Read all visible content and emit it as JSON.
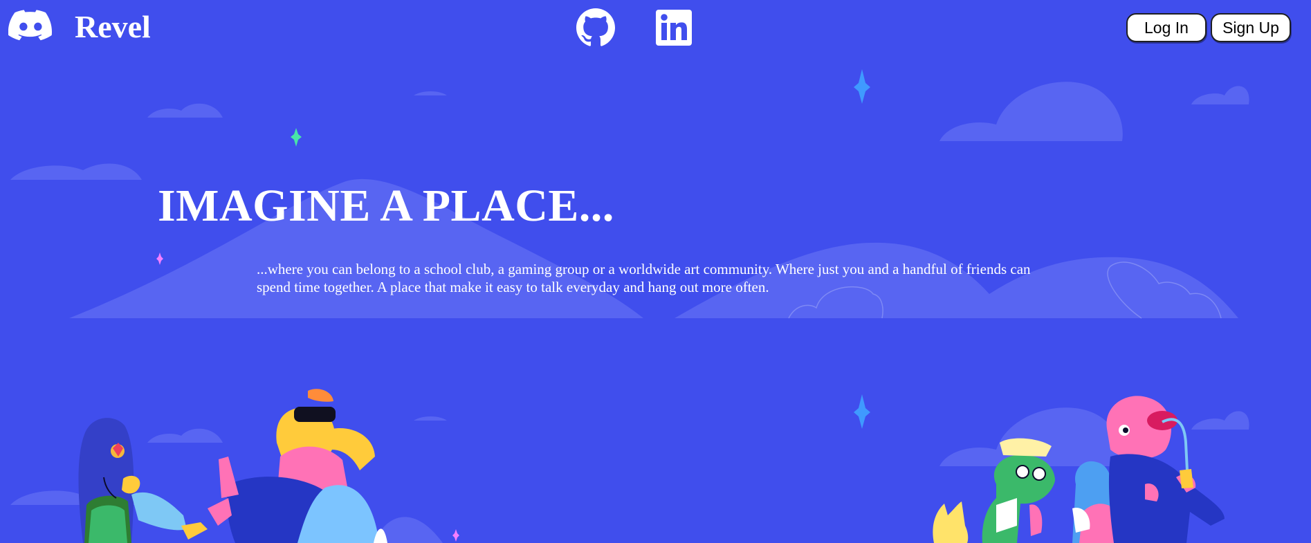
{
  "header": {
    "brand_icon": "discord-logo-icon",
    "brand_name": "Revel",
    "social_links": [
      {
        "icon": "github-icon",
        "label": "GitHub"
      },
      {
        "icon": "linkedin-icon",
        "label": "LinkedIn"
      }
    ],
    "login_label": "Log In",
    "signup_label": "Sign Up"
  },
  "hero": {
    "title": "IMAGINE A PLACE...",
    "description": "...where you can belong to a school club, a gaming group or a worldwide art community. Where just you and a handful of friends can spend time together. A place that make it easy to talk everyday and hang out more often."
  },
  "theme": {
    "background": "#404eed",
    "text": "#ffffff",
    "cloud": "#5865f2",
    "button_bg": "#ffffff"
  }
}
